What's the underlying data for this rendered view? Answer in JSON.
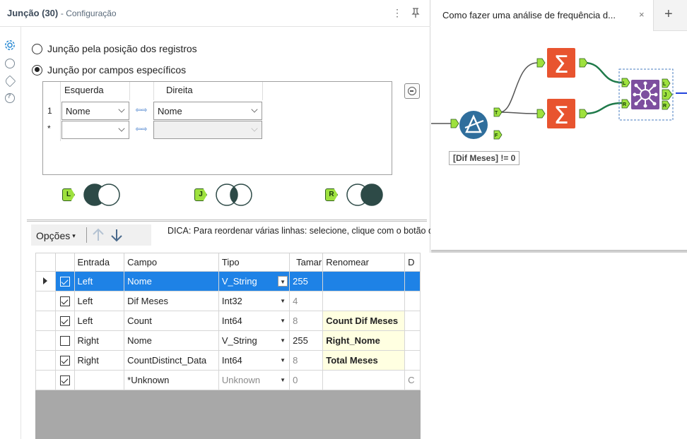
{
  "config": {
    "tool_name": "Junção (30)",
    "subtitle": "- Configuração",
    "more_label": "⋮",
    "pin_label": "🖈"
  },
  "join_options": {
    "by_position": "Junção pela posição dos registros",
    "by_fields": "Junção por campos específicos",
    "selected": "by_fields"
  },
  "join_grid": {
    "left_header": "Esquerda",
    "right_header": "Direita",
    "rows": [
      {
        "num": "1",
        "left": "Nome",
        "right": "Nome"
      },
      {
        "num": "*",
        "left": "",
        "right": ""
      }
    ],
    "swap_label": "⇦⇨"
  },
  "join_outputs": [
    {
      "tag": "L",
      "name": "left"
    },
    {
      "tag": "J",
      "name": "inner"
    },
    {
      "tag": "R",
      "name": "right"
    }
  ],
  "toolbar": {
    "options_label": "Opções",
    "caret": "▾",
    "hint": "DICA: Para reordenar várias linhas: selecione, clique com o botão direito e arraste."
  },
  "fields_table": {
    "columns": [
      "Entrada",
      "Campo",
      "Tipo",
      "Tamar",
      "Renomear",
      "D"
    ],
    "rows": [
      {
        "checked": true,
        "entrada": "Left",
        "campo": "Nome",
        "tipo": "V_String",
        "tamanho": "255",
        "renomear": "",
        "selected": true,
        "grey_size": false,
        "grey_type": false
      },
      {
        "checked": true,
        "entrada": "Left",
        "campo": "Dif Meses",
        "tipo": "Int32",
        "tamanho": "4",
        "renomear": "",
        "selected": false,
        "grey_size": true,
        "grey_type": false
      },
      {
        "checked": true,
        "entrada": "Left",
        "campo": "Count",
        "tipo": "Int64",
        "tamanho": "8",
        "renomear": "Count Dif Meses",
        "selected": false,
        "grey_size": true,
        "grey_type": false
      },
      {
        "checked": false,
        "entrada": "Right",
        "campo": "Nome",
        "tipo": "V_String",
        "tamanho": "255",
        "renomear": "Right_Nome",
        "selected": false,
        "grey_size": false,
        "grey_type": false
      },
      {
        "checked": true,
        "entrada": "Right",
        "campo": "CountDistinct_Data",
        "tipo": "Int64",
        "tamanho": "8",
        "renomear": "Total Meses",
        "selected": false,
        "grey_size": true,
        "grey_type": false
      },
      {
        "checked": true,
        "entrada": "",
        "campo": "*Unknown",
        "tipo": "Unknown",
        "tamanho": "0",
        "renomear": "",
        "selected": false,
        "grey_size": true,
        "grey_type": true,
        "extra": "C"
      }
    ]
  },
  "canvas": {
    "tab_title": "Como fazer uma análise de frequência d...",
    "close_label": "×",
    "add_label": "+",
    "filter_annotation": "[Dif Meses] != 0",
    "anchor_labels": {
      "in_l": "L",
      "in_r": "R",
      "out_l": "L",
      "out_j": "J",
      "out_r": "R",
      "filter_t": "T",
      "filter_f": "F"
    }
  },
  "colors": {
    "selection": "#1e82e6",
    "rename_bg": "#ffffe1",
    "summarize": "#e8542f",
    "join": "#7d4f9f",
    "filter": "#2f6e9c",
    "anchor": "#9ee13e",
    "connector": "#1f7a4a"
  }
}
